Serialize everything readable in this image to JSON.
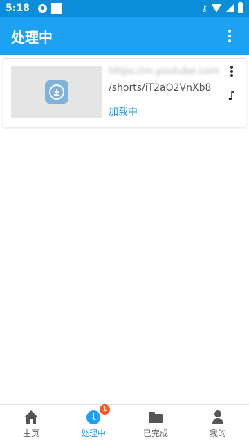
{
  "status_bar": {
    "time": "5:18",
    "icons": [
      "user-download-icon",
      "notification-square-icon",
      "vpn-key-icon",
      "wifi-icon",
      "signal-icon",
      "battery-icon"
    ]
  },
  "app_bar": {
    "title": "处理中",
    "menu_icon": "more-vert-icon"
  },
  "card": {
    "url_blurred": "https://m.youtube.com",
    "url_path": "/shorts/iT2aO2VnXb8",
    "status": "加载中",
    "thumbnail_icon": "download-app-icon",
    "menu_icon": "more-vert-icon",
    "type_icon": "music-note-icon"
  },
  "bottom_nav": {
    "items": [
      {
        "label": "主页",
        "icon": "home-icon",
        "active": false
      },
      {
        "label": "处理中",
        "icon": "clock-icon",
        "active": true,
        "badge": "1"
      },
      {
        "label": "已完成",
        "icon": "folder-icon",
        "active": false
      },
      {
        "label": "我的",
        "icon": "person-icon",
        "active": false
      }
    ]
  },
  "colors": {
    "status_bar": "#0a8ed9",
    "app_bar": "#1da1f2",
    "accent": "#1da1f2",
    "badge": "#ff5722",
    "status_text": "#1e9ee6"
  }
}
